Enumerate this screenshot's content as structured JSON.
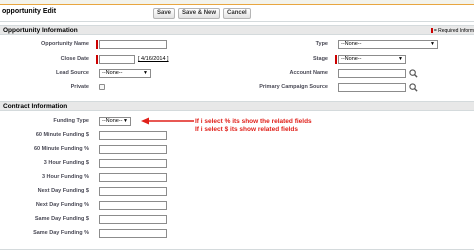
{
  "page": {
    "title": "opportunity Edit"
  },
  "toolbar": {
    "save_label": "Save",
    "save_new_label": "Save & New",
    "cancel_label": "Cancel"
  },
  "sections": {
    "opportunity_info": {
      "title": "Opportunity Information",
      "required_note": "= Required Inform"
    },
    "contract_info": {
      "title": "Contract Information"
    }
  },
  "opportunity_fields": {
    "opportunity_name": {
      "label": "Opportunity Name",
      "value": ""
    },
    "close_date": {
      "label": "Close Date",
      "value": "",
      "today_link": "[ 4/16/2014 ]"
    },
    "lead_source": {
      "label": "Lead Source",
      "value": "--None--"
    },
    "private": {
      "label": "Private"
    },
    "type": {
      "label": "Type",
      "value": "--None--"
    },
    "stage": {
      "label": "Stage",
      "value": "--None--"
    },
    "account_name": {
      "label": "Account Name",
      "value": ""
    },
    "primary_campaign_source": {
      "label": "Primary Campaign Source",
      "value": ""
    }
  },
  "contract_fields": {
    "funding_type": {
      "label": "Funding Type",
      "value": "--None--"
    },
    "rows": [
      {
        "label": "60 Minute Funding $",
        "value": ""
      },
      {
        "label": "60 Minute Funding %",
        "value": ""
      },
      {
        "label": "3 Hour Funding $",
        "value": ""
      },
      {
        "label": "3 Hour Funding %",
        "value": ""
      },
      {
        "label": "Next Day Funding $",
        "value": ""
      },
      {
        "label": "Next Day Funding %",
        "value": ""
      },
      {
        "label": "Same Day Funding $",
        "value": ""
      },
      {
        "label": "Same Day Funding %",
        "value": ""
      }
    ]
  },
  "annotations": {
    "line1": "If i select % its show the related fields",
    "line2": "If i select $ its show related fields"
  },
  "colors": {
    "required": "#cc0000",
    "annotation": "#e0201a",
    "section_bg": "#e8e8e8",
    "accent_border": "#e8a640"
  },
  "icons": {
    "dropdown": "▼",
    "lookup": "magnifier-icon"
  }
}
